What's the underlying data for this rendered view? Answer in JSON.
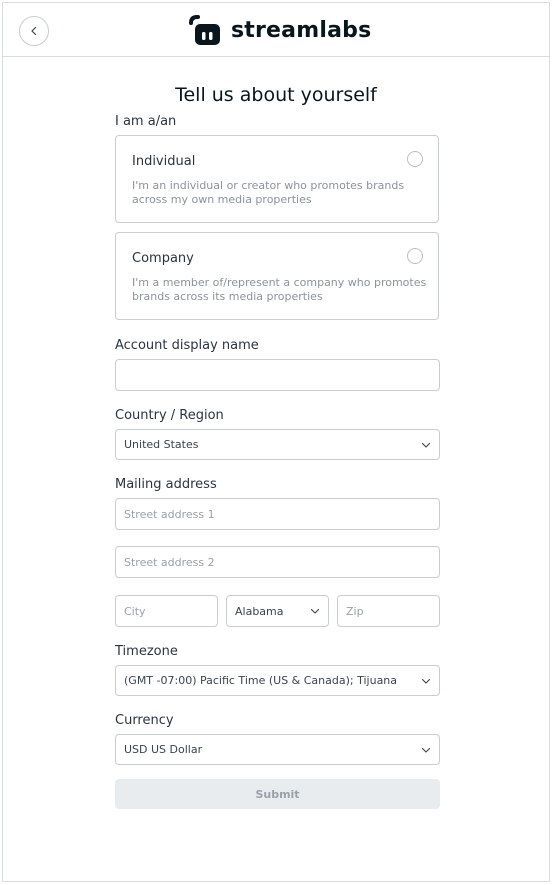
{
  "header": {
    "back_icon": "chevron-left-icon",
    "logo_text": "streamlabs",
    "brand_color": "#09161d"
  },
  "form": {
    "title": "Tell us about yourself",
    "type_label": "I am a/an",
    "options": [
      {
        "title": "Individual",
        "description": "I'm an individual or creator who promotes brands across my own media properties",
        "selected": false
      },
      {
        "title": "Company",
        "description": "I'm a member of/represent a company who promotes brands across its media properties",
        "selected": false
      }
    ],
    "display_name": {
      "label": "Account display name",
      "value": "",
      "placeholder": ""
    },
    "country": {
      "label": "Country / Region",
      "value": "United States"
    },
    "address": {
      "label": "Mailing address",
      "street1_placeholder": "Street address 1",
      "street2_placeholder": "Street address 2",
      "city_placeholder": "City",
      "state_value": "Alabama",
      "zip_placeholder": "Zip"
    },
    "timezone": {
      "label": "Timezone",
      "value": "(GMT -07:00) Pacific Time (US & Canada); Tijuana"
    },
    "currency": {
      "label": "Currency",
      "value": "USD US Dollar"
    },
    "submit_label": "Submit"
  }
}
